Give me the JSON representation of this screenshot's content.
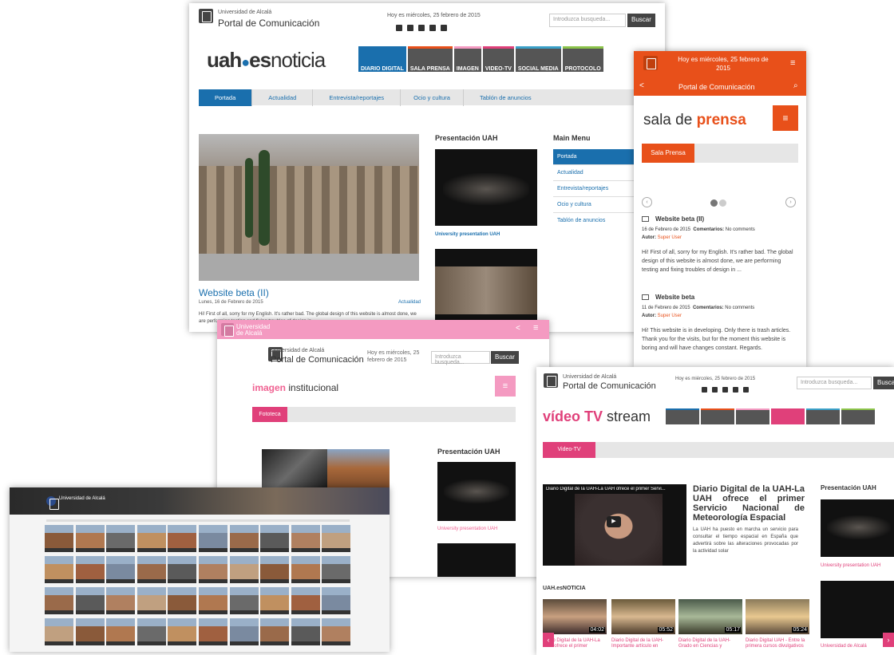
{
  "main": {
    "univ": "Universidad de Alcalá",
    "portal": "Portal de Comunicación",
    "date": "Hoy es miércoles, 25 febrero de 2015",
    "search_placeholder": "Introduzca busqueda...",
    "search_btn": "Buscar",
    "brand_a": "uah",
    "brand_b": "es",
    "brand_c": "noticia",
    "navtabs": [
      "DIARIO DIGITAL",
      "SALA PRENSA",
      "IMAGEN",
      "VIDEO-TV",
      "SOCIAL MEDIA",
      "PROTOCOLO"
    ],
    "subnav": [
      "Portada",
      "Actualidad",
      "Entrevista/reportajes",
      "Ocio y cultura",
      "Tablón de anuncios"
    ],
    "article_title": "Website beta (II)",
    "article_date": "Lunes, 16 de Febrero de 2015",
    "article_cat": "Actualidad",
    "article_text": "Hi! First of all, sorry for my English. It's rather bad. The global design of this website is almost done, we are performing testing and fixing troubles of design in ...",
    "presentacion": "Presentación UAH",
    "univ_present": "University presentation UAH",
    "main_menu": "Main Menu",
    "menu_items": [
      "Portada",
      "Actualidad",
      "Entrevista/reportajes",
      "Ocio y cultura",
      "Tablón de anuncios"
    ]
  },
  "prensa": {
    "date": "Hoy es miércoles, 25 febrero de 2015",
    "portal": "Portal de Comunicación",
    "title_a": "sala de",
    "title_b": "prensa",
    "tab": "Sala Prensa",
    "post1_title": "Website beta (II)",
    "post1_meta": "16 de Febrero de 2015",
    "comments_label": "Comentarios:",
    "comments_val": "No comments",
    "author_label": "Autor:",
    "author_val": "Super User",
    "post1_text": "Hi! First of all, sorry for my English. It's rather bad. The global design of this website is almost done, we are performing testing and fixing troubles of design in ...",
    "post2_title": "Website beta",
    "post2_meta": "11 de Febrero de 2015",
    "post2_text": "Hi! This website is in developing. Only there is trash articles. Thank you for the visits, but for the moment this website is boring and will have changes constant. Regards."
  },
  "imagen": {
    "topbar_logo": "Universidad de Alcalá",
    "univ": "Universidad de Alcalá",
    "portal": "Portal de Comunicación",
    "date": "Hoy es miércoles, 25 febrero de 2015",
    "search_placeholder": "Introduzca busqueda...",
    "search_btn": "Buscar",
    "title_a": "imagen",
    "title_b": "institucional",
    "tab": "Fototeca",
    "presentacion": "Presentación UAH",
    "univ_present": "University presentation UAH"
  },
  "video": {
    "univ": "Universidad de Alcalá",
    "portal": "Portal de Comunicación",
    "date": "Hoy es miércoles, 25 febrero de 2015",
    "search_placeholder": "Introduzca busqueda...",
    "search_btn": "Buscar",
    "title_a": "vídeo TV",
    "title_b": "stream",
    "tab": "Video-TV",
    "video_caption": "Diario Digital de la UAH-La UAH ofrece el primer Servi...",
    "headline": "Diario Digital de la UAH-La UAH ofrece el primer Servicio Nacional de Meteorología Espacial",
    "body": "La UAH ha puesto en marcha un servicio para consultar el tiempo espacial en España que advertirá sobre las alteraciones provocadas por la actividad solar",
    "presentacion": "Presentación UAH",
    "univ_present": "University presentation UAH",
    "univ_alcala": "Universidad de Alcalá",
    "section": "UAH.esNOTICIA",
    "thumbs": [
      {
        "time": "04:02",
        "cap": "Diario Digital de la UAH-La UAH ofrece el primer"
      },
      {
        "time": "05:52",
        "cap": "Diario Digital de la UAH-Importante artículo en"
      },
      {
        "time": "05:17",
        "cap": "Diario Digital de la UAH-Grado en Ciencias y"
      },
      {
        "time": "05:24",
        "cap": "Diario Digital UAH - Entre la primera cursos divulgativos"
      }
    ]
  },
  "gallery": {
    "univ": "Universidad de Alcalá"
  }
}
